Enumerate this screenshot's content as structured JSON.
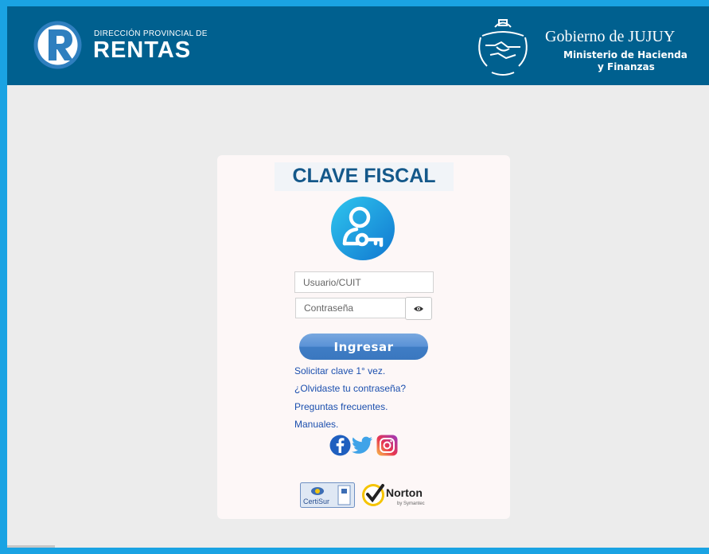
{
  "header": {
    "brand_small": "DIRECCIÓN PROVINCIAL DE",
    "brand_big": "RENTAS",
    "gov_title": "Gobierno de JUJUY",
    "gov_sub1": "Ministerio de Hacienda",
    "gov_sub2": "y Finanzas",
    "logo_icon": "rentas-r-logo",
    "emblem_icon": "jujuy-emblem"
  },
  "login": {
    "title": "CLAVE FISCAL",
    "user_placeholder": "Usuario/CUIT",
    "password_placeholder": "Contraseña",
    "submit_label": "Ingresar",
    "links": [
      "Solicitar clave 1° vez.",
      "¿Olvidaste tu contraseña?",
      "Preguntas frecuentes.",
      "Manuales."
    ]
  },
  "social": {
    "facebook_icon": "facebook-icon",
    "twitter_icon": "twitter-icon",
    "instagram_icon": "instagram-icon"
  },
  "seals": {
    "certisur_label": "CertiSur",
    "norton_label": "Norton",
    "norton_sub": "by Symantec"
  },
  "colors": {
    "border": "#1aa3e3",
    "header": "#00608f",
    "title": "#14588a",
    "link": "#1b4fae"
  }
}
